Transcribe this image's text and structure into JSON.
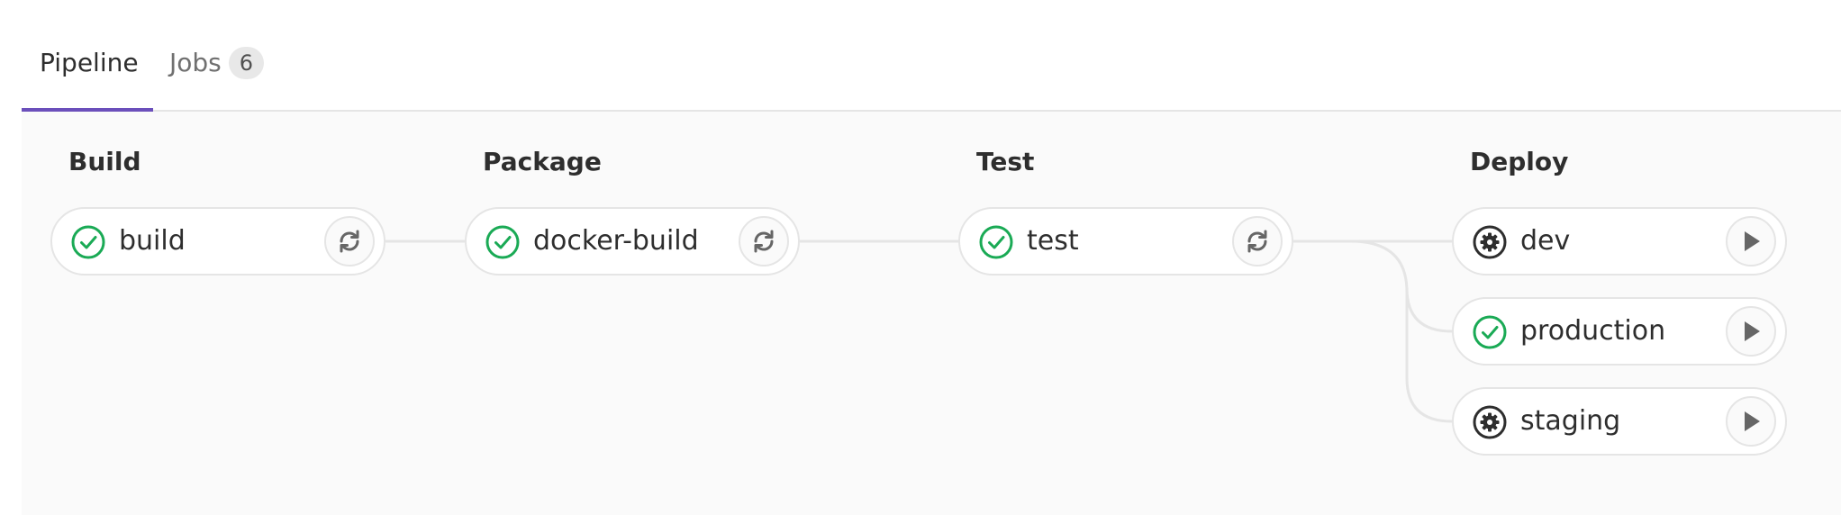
{
  "tabs": {
    "pipeline": "Pipeline",
    "jobs": "Jobs",
    "jobs_count": "6"
  },
  "stages": {
    "build": "Build",
    "package": "Package",
    "test": "Test",
    "deploy": "Deploy"
  },
  "jobs": {
    "build": {
      "name": "build",
      "status": "success",
      "status_icon": "check-circle-icon",
      "action_icon": "retry-icon"
    },
    "docker_build": {
      "name": "docker-build",
      "status": "success",
      "status_icon": "check-circle-icon",
      "action_icon": "retry-icon"
    },
    "test": {
      "name": "test",
      "status": "success",
      "status_icon": "check-circle-icon",
      "action_icon": "retry-icon"
    },
    "dev": {
      "name": "dev",
      "status": "manual",
      "status_icon": "gear-icon",
      "action_icon": "play-icon"
    },
    "production": {
      "name": "production",
      "status": "success",
      "status_icon": "check-circle-icon",
      "action_icon": "play-icon"
    },
    "staging": {
      "name": "staging",
      "status": "manual",
      "status_icon": "gear-icon",
      "action_icon": "play-icon"
    }
  },
  "colors": {
    "accent": "#6b4fbb",
    "success": "#1aaa55",
    "manual": "#2e2e2e"
  }
}
